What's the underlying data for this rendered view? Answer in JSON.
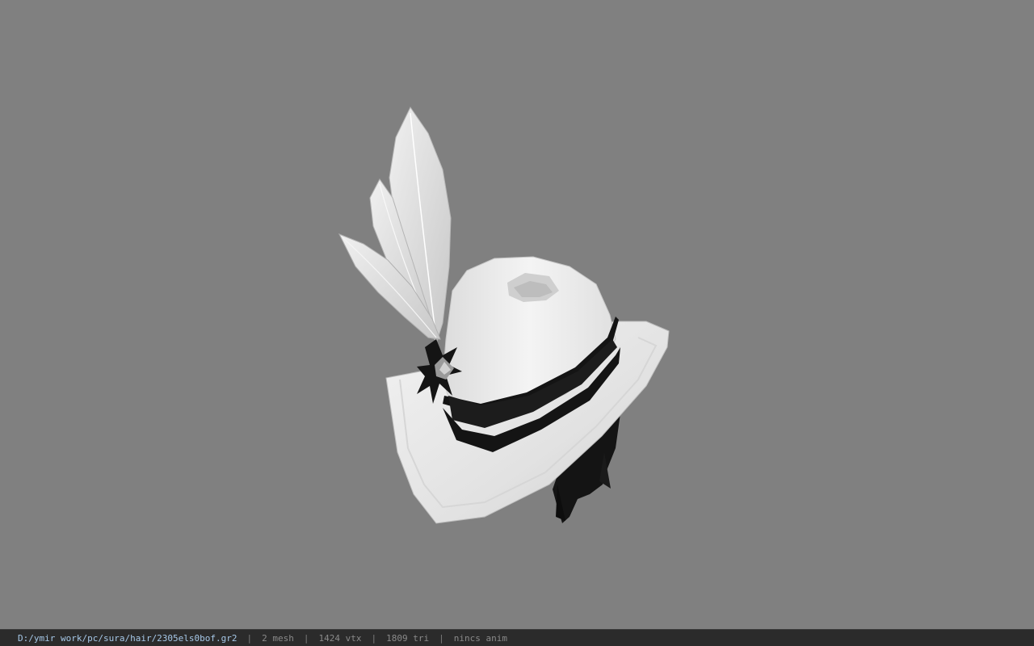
{
  "status_bar": {
    "file_path": "D:/ymir work/pc/sura/hair/2305els0bof.gr2",
    "separator": "|",
    "mesh_count": "2 mesh",
    "vertex_count": "1424 vtx",
    "triangle_count": "1809 tri",
    "anim_status": "nincs anim"
  },
  "viewport": {
    "background_color": "#808080",
    "model": "feathered-hat-model"
  }
}
